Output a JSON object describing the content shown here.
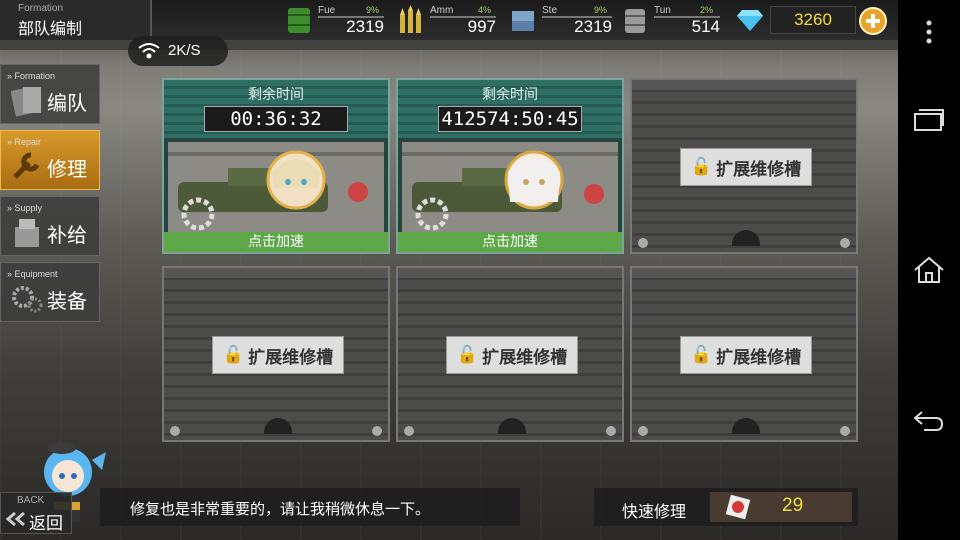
{
  "header": {
    "title_en": "Formation",
    "title_zh": "部队编制"
  },
  "resources": [
    {
      "label": "Fue",
      "percent": "9%",
      "value": "2319",
      "icon": "fuel-barrel-icon",
      "color": "#3e8d2e"
    },
    {
      "label": "Amm",
      "percent": "4%",
      "value": "997",
      "icon": "ammo-bullets-icon",
      "color": "#d4b33a"
    },
    {
      "label": "Ste",
      "percent": "9%",
      "value": "2319",
      "icon": "steel-ingot-icon",
      "color": "#5a7fa8"
    },
    {
      "label": "Tun",
      "percent": "2%",
      "value": "514",
      "icon": "tungsten-barrel-icon",
      "color": "#9a9a9a"
    }
  ],
  "gems": {
    "value": "3260",
    "icon": "diamond-icon",
    "add_icon": "plus-circle-icon"
  },
  "network": {
    "speed": "2K/S",
    "icon": "wifi-icon"
  },
  "sidebar": [
    {
      "en": "Formation",
      "zh": "编队",
      "icon": "formation-cards-icon",
      "active": false
    },
    {
      "en": "Repair",
      "zh": "修理",
      "icon": "repair-wrench-icon",
      "active": true
    },
    {
      "en": "Supply",
      "zh": "补给",
      "icon": "supply-box-icon",
      "active": false
    },
    {
      "en": "Equipment",
      "zh": "装备",
      "icon": "equipment-gears-icon",
      "active": false
    }
  ],
  "repair_slots": {
    "active": [
      {
        "header": "剩余时间",
        "timer": "00:36:32",
        "speed_up": "点击加速"
      },
      {
        "header": "剩余时间",
        "timer": "412574:50:45",
        "speed_up": "点击加速"
      }
    ],
    "locked_label": "扩展维修槽",
    "locked_count": 4
  },
  "message": "修复也是非常重要的，请让我稍微休息一下。",
  "quick_repair": {
    "label": "快速修理",
    "count": "29",
    "icon": "quick-repair-ticket-icon"
  },
  "back": {
    "en": "BACK",
    "zh": "返回"
  },
  "system_nav": [
    "more-vert-icon",
    "recent-apps-icon",
    "home-icon",
    "back-arrow-icon"
  ]
}
